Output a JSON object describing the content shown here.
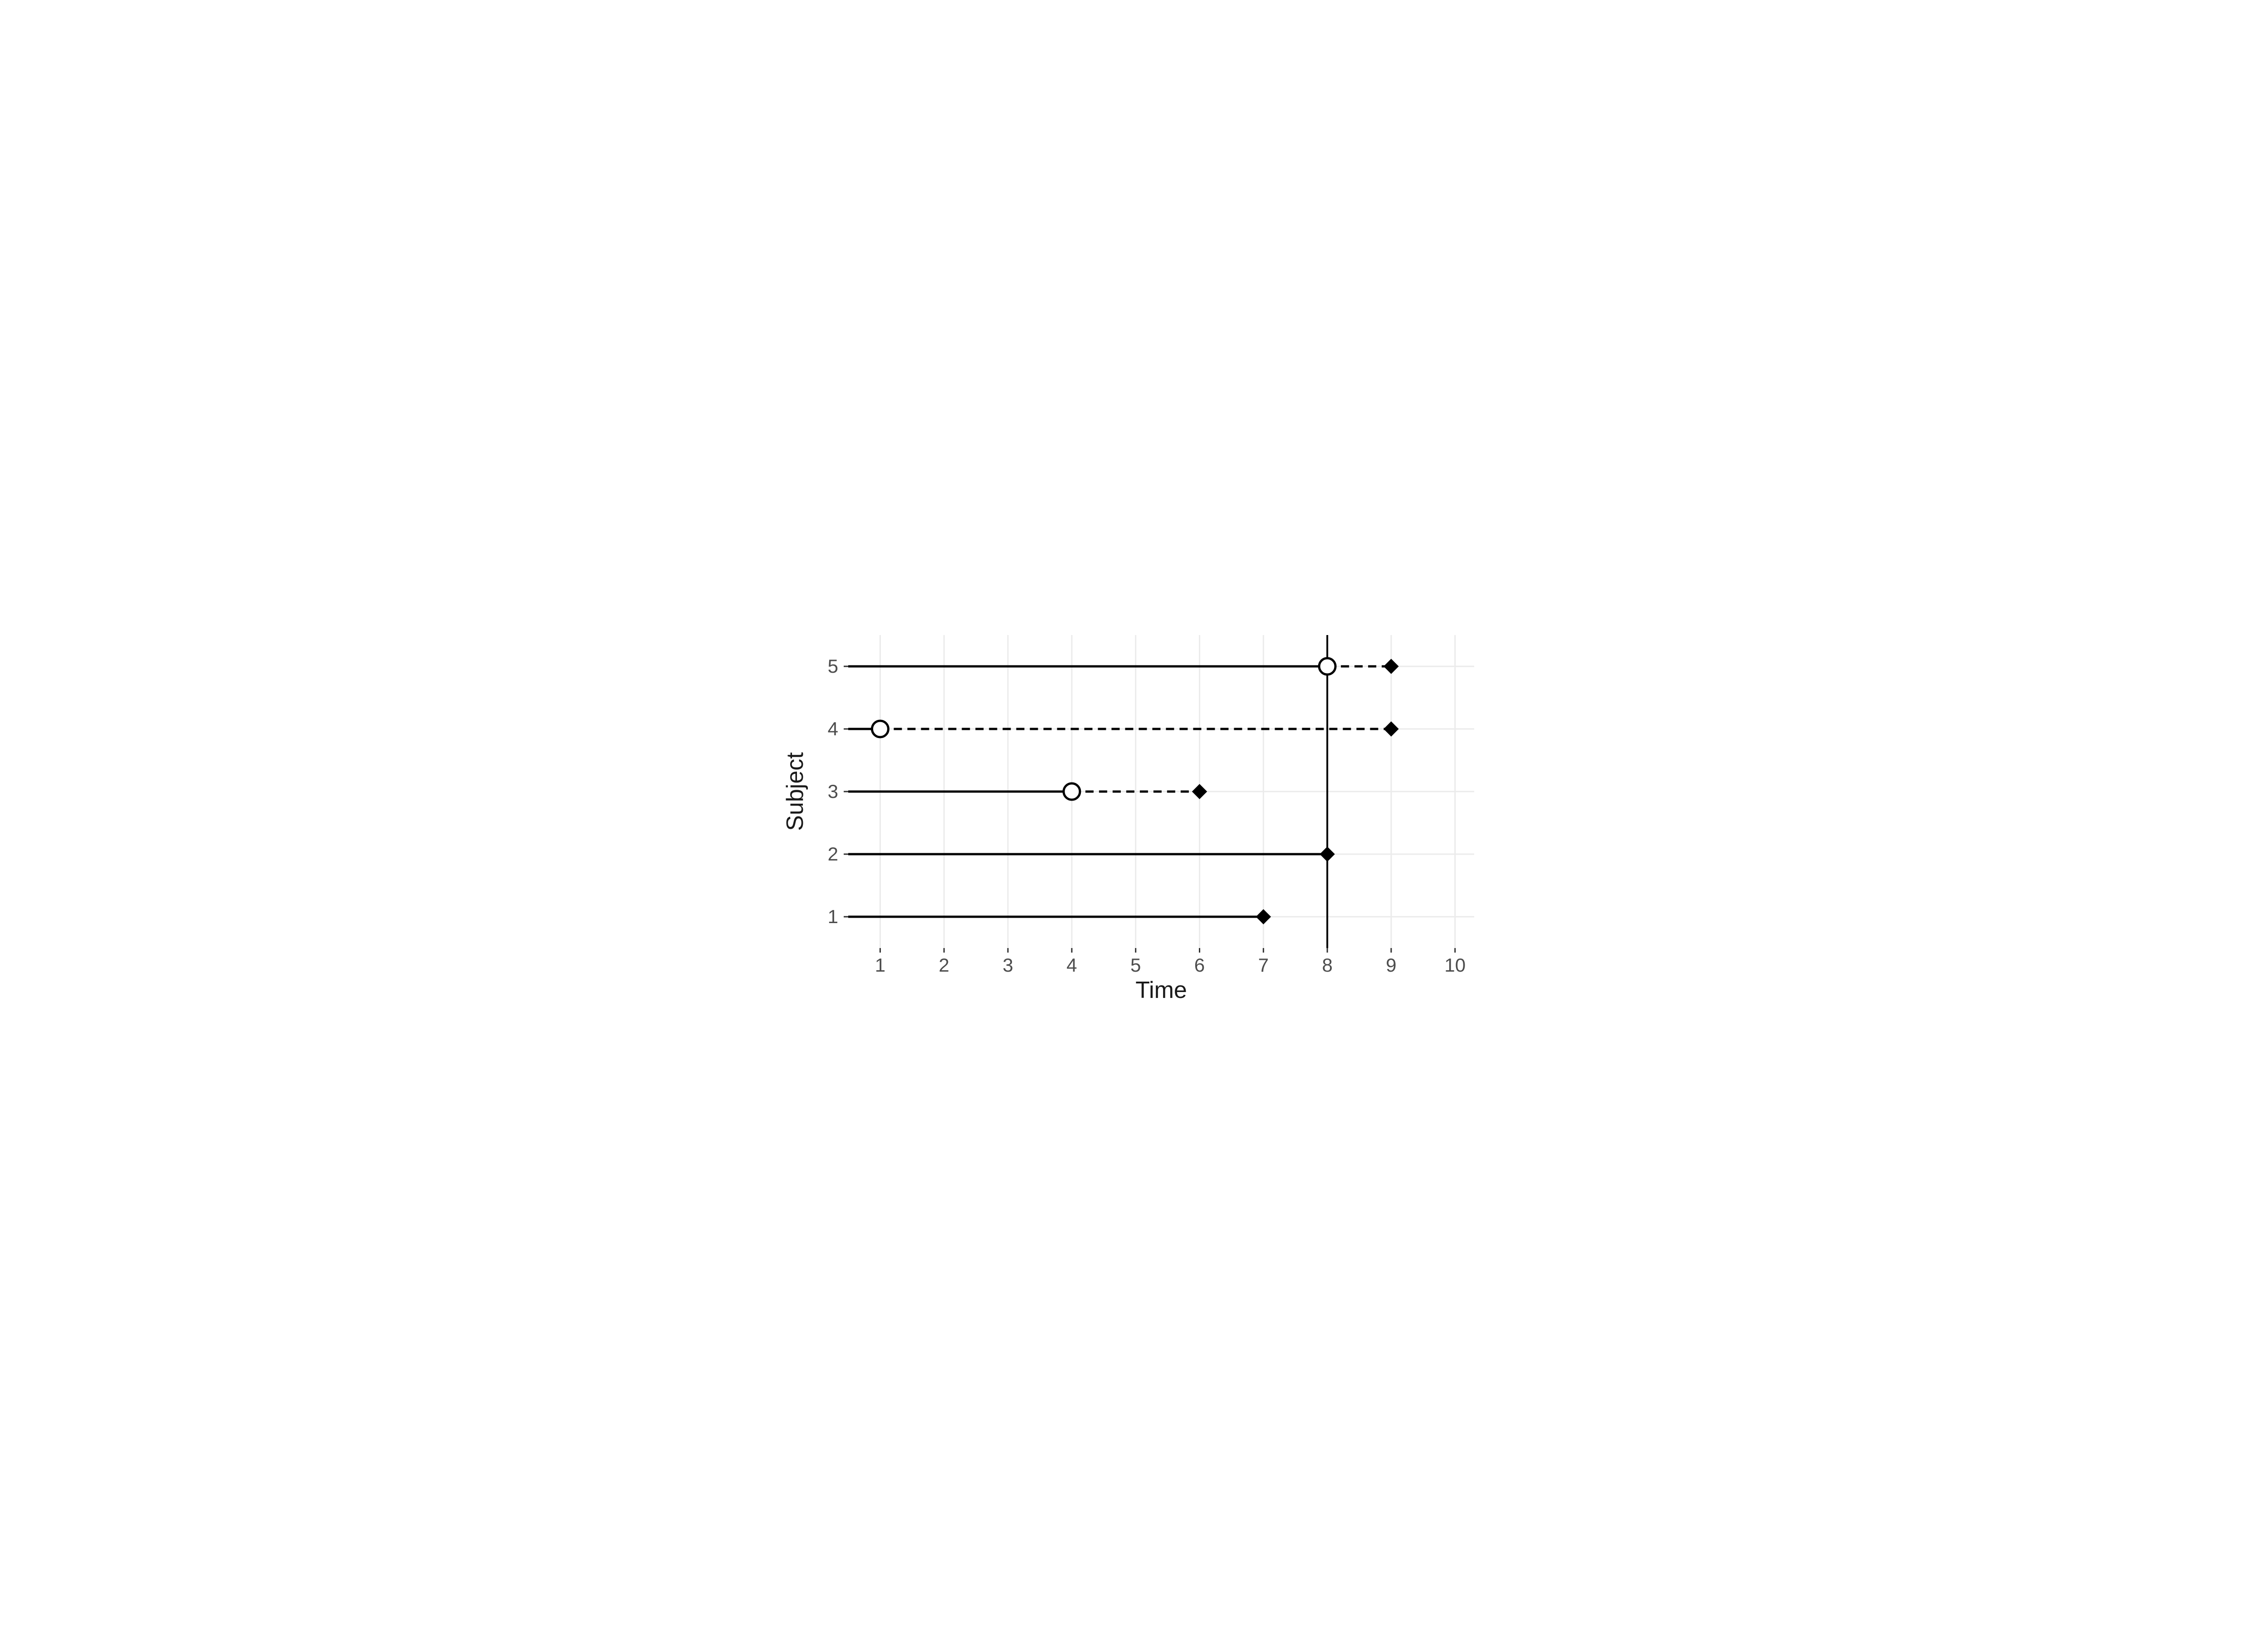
{
  "chart_data": {
    "type": "other",
    "title": "",
    "xlabel": "Time",
    "ylabel": "Subject",
    "xlim": [
      0.5,
      10.3
    ],
    "ylim": [
      0.5,
      5.5
    ],
    "x_ticks": [
      1,
      2,
      3,
      4,
      5,
      6,
      7,
      8,
      9,
      10
    ],
    "y_ticks": [
      1,
      2,
      3,
      4,
      5
    ],
    "vline_x": 8,
    "series": [
      {
        "subject": 1,
        "solid_start": 0.5,
        "solid_end": 7,
        "dash_end": null,
        "circle_x": null,
        "diamond_x": 7
      },
      {
        "subject": 2,
        "solid_start": 0.5,
        "solid_end": 8,
        "dash_end": null,
        "circle_x": null,
        "diamond_x": 8
      },
      {
        "subject": 3,
        "solid_start": 0.5,
        "solid_end": 4,
        "dash_end": 6,
        "circle_x": 4,
        "diamond_x": 6
      },
      {
        "subject": 4,
        "solid_start": 0.5,
        "solid_end": 1,
        "dash_end": 9,
        "circle_x": 1,
        "diamond_x": 9
      },
      {
        "subject": 5,
        "solid_start": 0.5,
        "solid_end": 8,
        "dash_end": 9,
        "circle_x": 8,
        "diamond_x": 9
      }
    ]
  },
  "labels": {
    "xlabel": "Time",
    "ylabel": "Subject",
    "xticks": {
      "1": "1",
      "2": "2",
      "3": "3",
      "4": "4",
      "5": "5",
      "6": "6",
      "7": "7",
      "8": "8",
      "9": "9",
      "10": "10"
    },
    "yticks": {
      "1": "1",
      "2": "2",
      "3": "3",
      "4": "4",
      "5": "5"
    }
  }
}
